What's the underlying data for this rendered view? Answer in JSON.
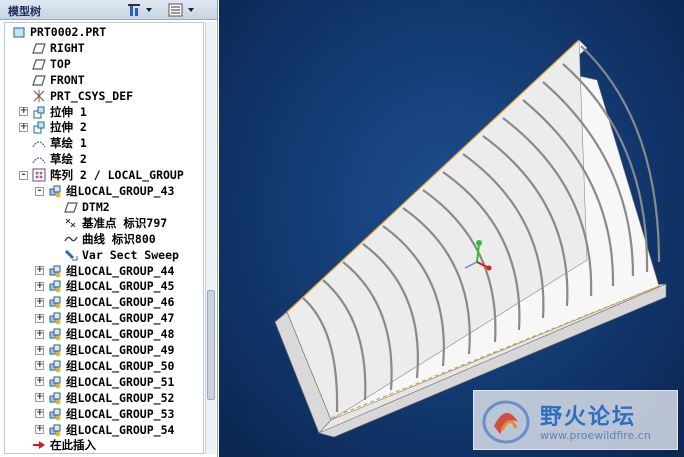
{
  "panel": {
    "title": "模型树",
    "settings_icon": "tree-settings-icon",
    "show_icon": "tree-show-icon"
  },
  "tree": [
    {
      "label": "PRT0002.PRT",
      "icon": "part-icon",
      "expander": ""
    },
    {
      "label": "RIGHT",
      "icon": "datum-plane-icon",
      "expander": ""
    },
    {
      "label": "TOP",
      "icon": "datum-plane-icon",
      "expander": ""
    },
    {
      "label": "FRONT",
      "icon": "datum-plane-icon",
      "expander": ""
    },
    {
      "label": "PRT_CSYS_DEF",
      "icon": "csys-icon",
      "expander": ""
    },
    {
      "label": "拉伸 1",
      "icon": "extrude-icon",
      "expander": "+"
    },
    {
      "label": "拉伸 2",
      "icon": "extrude-icon",
      "expander": "+"
    },
    {
      "label": "草绘 1",
      "icon": "sketch-icon",
      "expander": ""
    },
    {
      "label": "草绘 2",
      "icon": "sketch-icon",
      "expander": ""
    },
    {
      "label": "阵列 2 / LOCAL_GROUP",
      "icon": "pattern-icon",
      "expander": "-"
    },
    {
      "label": "组LOCAL_GROUP_43",
      "icon": "group-icon",
      "expander": "-"
    },
    {
      "label": "DTM2",
      "icon": "datum-plane-icon",
      "expander": ""
    },
    {
      "label": "基准点 标识797",
      "icon": "datum-point-icon",
      "expander": ""
    },
    {
      "label": "曲线 标识800",
      "icon": "curve-icon",
      "expander": ""
    },
    {
      "label": "Var Sect Sweep",
      "icon": "sweep-icon",
      "expander": ""
    },
    {
      "label": "组LOCAL_GROUP_44",
      "icon": "group-icon",
      "expander": "+"
    },
    {
      "label": "组LOCAL_GROUP_45",
      "icon": "group-icon",
      "expander": "+"
    },
    {
      "label": "组LOCAL_GROUP_46",
      "icon": "group-icon",
      "expander": "+"
    },
    {
      "label": "组LOCAL_GROUP_47",
      "icon": "group-icon",
      "expander": "+"
    },
    {
      "label": "组LOCAL_GROUP_48",
      "icon": "group-icon",
      "expander": "+"
    },
    {
      "label": "组LOCAL_GROUP_49",
      "icon": "group-icon",
      "expander": "+"
    },
    {
      "label": "组LOCAL_GROUP_50",
      "icon": "group-icon",
      "expander": "+"
    },
    {
      "label": "组LOCAL_GROUP_51",
      "icon": "group-icon",
      "expander": "+"
    },
    {
      "label": "组LOCAL_GROUP_52",
      "icon": "group-icon",
      "expander": "+"
    },
    {
      "label": "组LOCAL_GROUP_53",
      "icon": "group-icon",
      "expander": "+"
    },
    {
      "label": "组LOCAL_GROUP_54",
      "icon": "group-icon",
      "expander": "+"
    },
    {
      "label": "在此插入",
      "icon": "insert-here-arrow-icon",
      "expander": ""
    }
  ],
  "watermark": {
    "title": "野火论坛",
    "url": "www.proewildfire.cn"
  },
  "colors": {
    "viewport_bg": "#12386f",
    "model_surface": "#f2f2f2",
    "edge_highlight": "#e0a030"
  }
}
